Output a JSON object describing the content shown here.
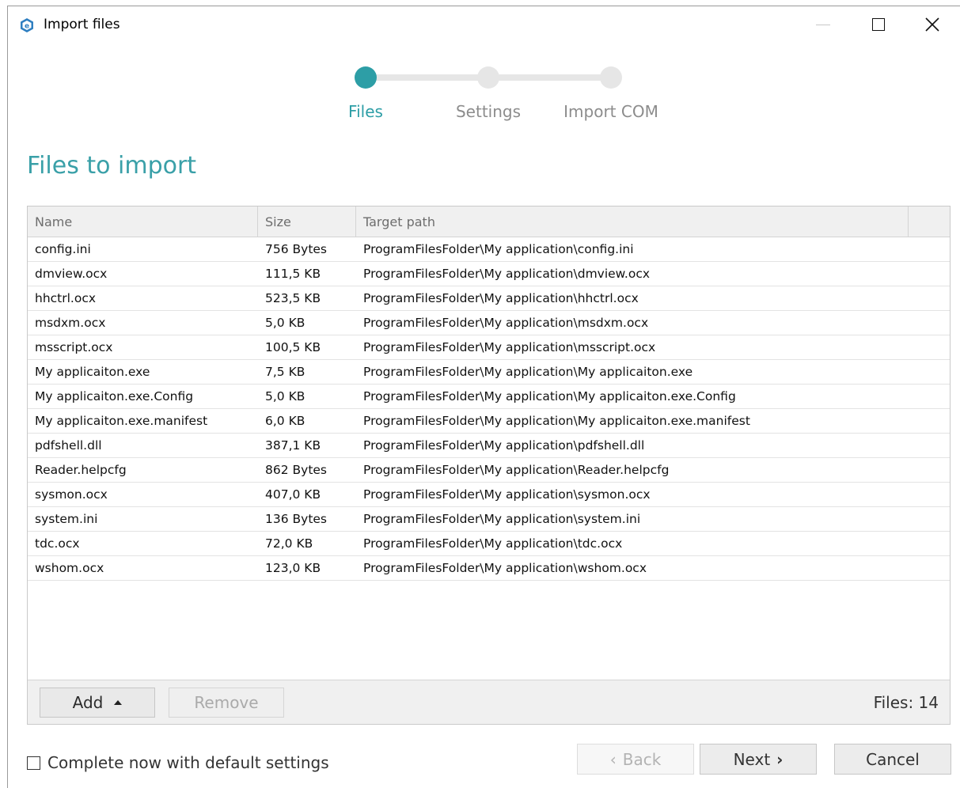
{
  "window": {
    "title": "Import files",
    "icons": {
      "app": "app-logo-icon",
      "minimize": "minimize-icon",
      "maximize": "maximize-icon",
      "close": "close-icon"
    }
  },
  "steps": [
    {
      "label": "Files",
      "active": true
    },
    {
      "label": "Settings",
      "active": false
    },
    {
      "label": "Import COM",
      "active": false
    }
  ],
  "heading": "Files to import",
  "table": {
    "columns": [
      "Name",
      "Size",
      "Target path"
    ],
    "rows": [
      {
        "name": "config.ini",
        "size": "756 Bytes",
        "path": "ProgramFilesFolder\\My application\\config.ini"
      },
      {
        "name": "dmview.ocx",
        "size": "111,5 KB",
        "path": "ProgramFilesFolder\\My application\\dmview.ocx"
      },
      {
        "name": "hhctrl.ocx",
        "size": "523,5 KB",
        "path": "ProgramFilesFolder\\My application\\hhctrl.ocx"
      },
      {
        "name": "msdxm.ocx",
        "size": "5,0 KB",
        "path": "ProgramFilesFolder\\My application\\msdxm.ocx"
      },
      {
        "name": "msscript.ocx",
        "size": "100,5 KB",
        "path": "ProgramFilesFolder\\My application\\msscript.ocx"
      },
      {
        "name": "My applicaiton.exe",
        "size": "7,5 KB",
        "path": "ProgramFilesFolder\\My application\\My applicaiton.exe"
      },
      {
        "name": "My applicaiton.exe.Config",
        "size": "5,0 KB",
        "path": "ProgramFilesFolder\\My application\\My applicaiton.exe.Config"
      },
      {
        "name": "My applicaiton.exe.manifest",
        "size": "6,0 KB",
        "path": "ProgramFilesFolder\\My application\\My applicaiton.exe.manifest"
      },
      {
        "name": "pdfshell.dll",
        "size": "387,1 KB",
        "path": "ProgramFilesFolder\\My application\\pdfshell.dll"
      },
      {
        "name": "Reader.helpcfg",
        "size": "862 Bytes",
        "path": "ProgramFilesFolder\\My application\\Reader.helpcfg"
      },
      {
        "name": "sysmon.ocx",
        "size": "407,0 KB",
        "path": "ProgramFilesFolder\\My application\\sysmon.ocx"
      },
      {
        "name": "system.ini",
        "size": "136 Bytes",
        "path": "ProgramFilesFolder\\My application\\system.ini"
      },
      {
        "name": "tdc.ocx",
        "size": "72,0 KB",
        "path": "ProgramFilesFolder\\My application\\tdc.ocx"
      },
      {
        "name": "wshom.ocx",
        "size": "123,0 KB",
        "path": "ProgramFilesFolder\\My application\\wshom.ocx"
      }
    ]
  },
  "footer": {
    "add_label": "Add",
    "remove_label": "Remove",
    "files_count": "Files: 14"
  },
  "bottom": {
    "checkbox_label": "Complete now with default settings",
    "checkbox_checked": false,
    "back_label": "Back",
    "next_label": "Next",
    "cancel_label": "Cancel"
  },
  "colors": {
    "accent": "#2d9ea6",
    "inactive_step": "#e6e6e6"
  }
}
